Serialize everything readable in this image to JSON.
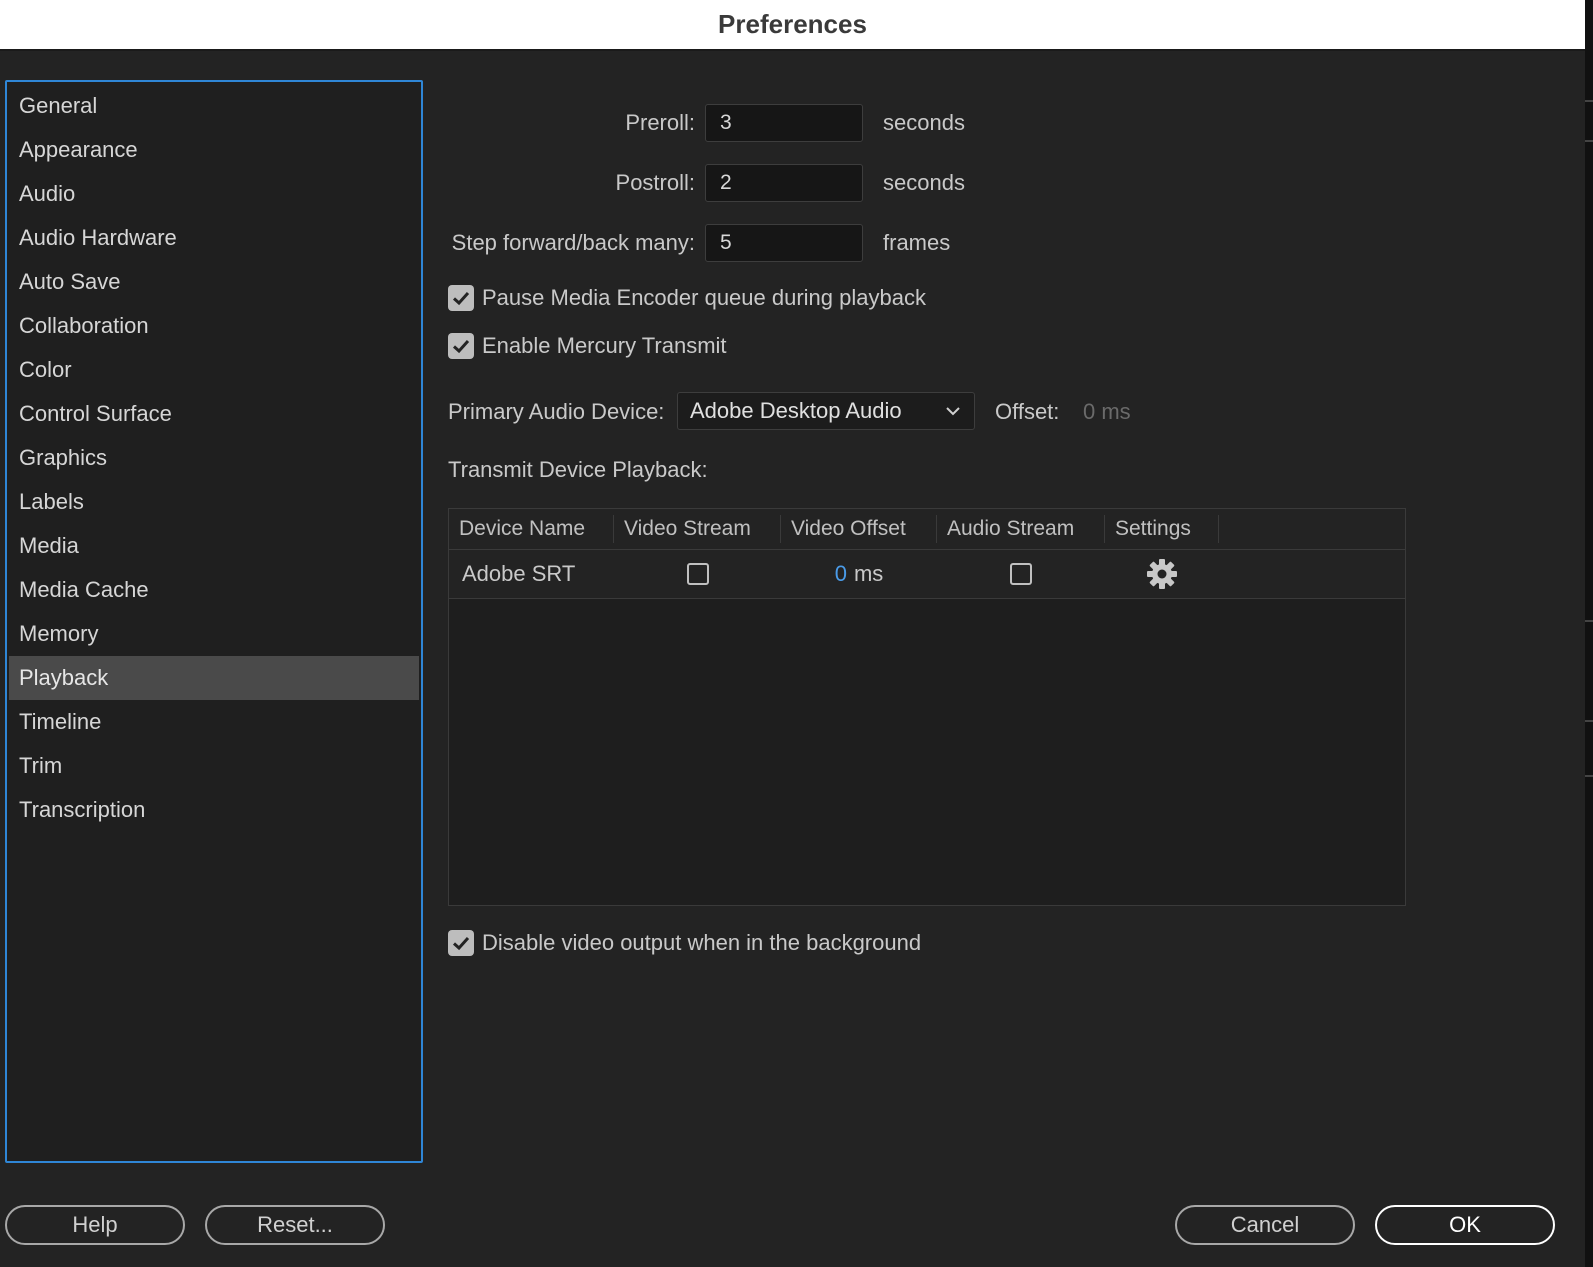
{
  "window": {
    "title": "Preferences"
  },
  "sidebar": {
    "items": [
      {
        "label": "General"
      },
      {
        "label": "Appearance"
      },
      {
        "label": "Audio"
      },
      {
        "label": "Audio Hardware"
      },
      {
        "label": "Auto Save"
      },
      {
        "label": "Collaboration"
      },
      {
        "label": "Color"
      },
      {
        "label": "Control Surface"
      },
      {
        "label": "Graphics"
      },
      {
        "label": "Labels"
      },
      {
        "label": "Media"
      },
      {
        "label": "Media Cache"
      },
      {
        "label": "Memory"
      },
      {
        "label": "Playback"
      },
      {
        "label": "Timeline"
      },
      {
        "label": "Trim"
      },
      {
        "label": "Transcription"
      }
    ],
    "selected": "Playback"
  },
  "playback": {
    "preroll": {
      "label": "Preroll:",
      "value": "3",
      "unit": "seconds"
    },
    "postroll": {
      "label": "Postroll:",
      "value": "2",
      "unit": "seconds"
    },
    "step": {
      "label": "Step forward/back many:",
      "value": "5",
      "unit": "frames"
    },
    "pause_encoder": {
      "label": "Pause Media Encoder queue during playback",
      "checked": true
    },
    "mercury": {
      "label": "Enable Mercury Transmit",
      "checked": true
    },
    "audio_device": {
      "label": "Primary Audio Device:",
      "value": "Adobe Desktop Audio"
    },
    "offset": {
      "label": "Offset:",
      "value": "0 ms"
    },
    "transmit_label": "Transmit Device Playback:",
    "table": {
      "headers": [
        "Device Name",
        "Video Stream",
        "Video Offset",
        "Audio Stream",
        "Settings"
      ],
      "rows": [
        {
          "device": "Adobe SRT",
          "video_stream": false,
          "offset_value": "0",
          "offset_unit": "ms",
          "audio_stream": false
        }
      ]
    },
    "disable_bg": {
      "label": "Disable video output when in the background",
      "checked": true
    }
  },
  "buttons": {
    "help": "Help",
    "reset": "Reset...",
    "cancel": "Cancel",
    "ok": "OK"
  },
  "colors": {
    "accent": "#2f86d6",
    "link": "#4a9be8",
    "selected_bg": "#4a4a4a"
  }
}
